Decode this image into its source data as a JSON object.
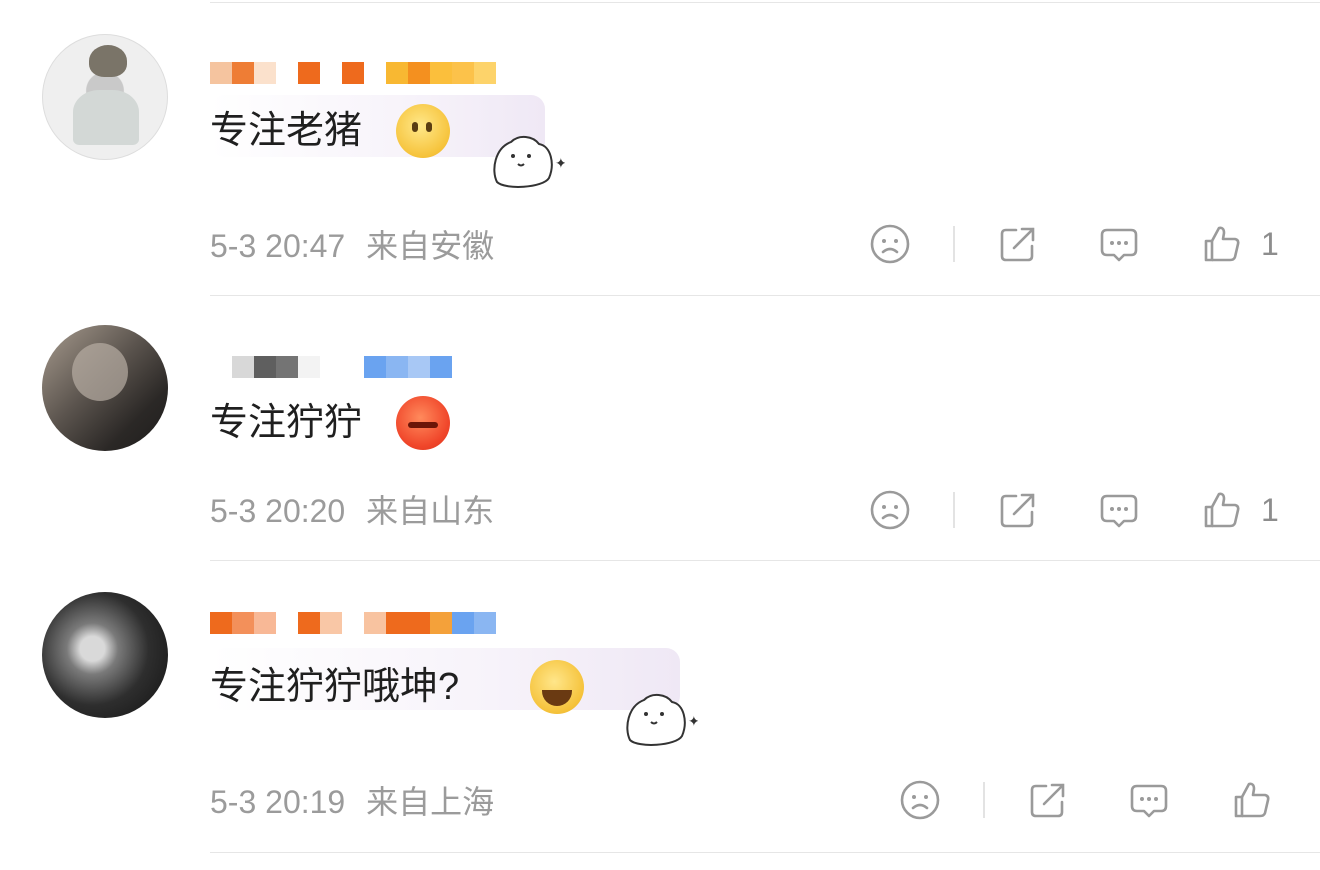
{
  "comments": [
    {
      "text": "专注老猪",
      "time": "5-3 20:47",
      "location": "来自安徽",
      "likes": "1",
      "emoji": "thinking-face-icon",
      "has_bear_sticker": true
    },
    {
      "text": "专注狞狞",
      "time": "5-3 20:20",
      "location": "来自山东",
      "likes": "1",
      "emoji": "angry-face-icon",
      "has_bear_sticker": false
    },
    {
      "text": "专注狞狞哦坤?",
      "time": "5-3 20:19",
      "location": "来自上海",
      "likes": "",
      "emoji": "laughing-tears-icon",
      "has_bear_sticker": true
    }
  ],
  "icons": {
    "dislike": "sad-face-icon",
    "share": "share-icon",
    "reply": "comment-icon",
    "like": "thumbs-up-icon"
  },
  "colors": {
    "meta_text": "#9b9b9b",
    "icon_gray": "#9a9a9a",
    "name_orange": "#ee6a1d",
    "name_blue": "#6aa3f0"
  }
}
